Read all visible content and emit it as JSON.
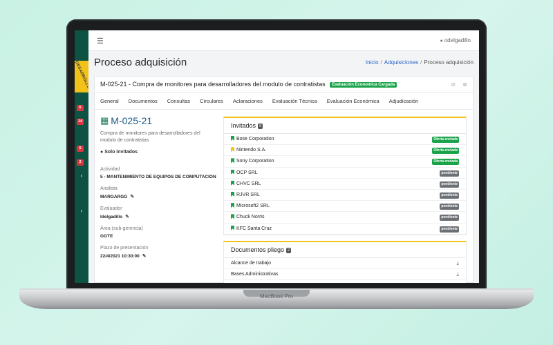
{
  "device": {
    "brand": "MacBook Pro"
  },
  "sidebar": {
    "ribbon": "DESARROLLO",
    "badges": [
      "6",
      "14",
      "5",
      "2"
    ],
    "chevron_icon": "chevron-left-icon"
  },
  "topbar": {
    "username": "odelgadillo"
  },
  "page": {
    "title": "Proceso adquisición",
    "breadcrumb": {
      "home": "Inicio",
      "section": "Adquisiciones",
      "current": "Proceso adquisición"
    }
  },
  "process": {
    "header": "M-025-21 - Compra de monitores para desarrolladores del modulo de contratistas",
    "status_badge": "Evaluación Economica Cargada",
    "code": "M-025-21",
    "description": "Compra de monitores para desarrolladores del modulo de contratistas",
    "mode": "Solo invitados",
    "fields": {
      "actividad_label": "Actividad",
      "actividad_value": "5 - MANTENIMIENTO DE EQUIPOS DE COMPUTACION",
      "analista_label": "Analista",
      "analista_value": "MARGARGG",
      "evaluador_label": "Evaluador",
      "evaluador_value": "ldelgadillo",
      "area_label": "Área (sub-gerencia)",
      "area_value": "GGTE",
      "plazo_label": "Plazo de presentación",
      "plazo_value": "22/4/2021 10:30:00"
    }
  },
  "tabs": [
    "General",
    "Documentos",
    "Consultas",
    "Circulares",
    "Aclaraciones",
    "Evaluación Técnica",
    "Evaluación Económica",
    "Adjudicación"
  ],
  "invitados": {
    "title": "Invitados",
    "count": "9",
    "rows": [
      {
        "name": "Bose Corporation",
        "status": "Oferta enviada",
        "color": "#1aa34a",
        "mark": "#1aa34a"
      },
      {
        "name": "Nintendo S.A.",
        "status": "Oferta enviada",
        "color": "#1aa34a",
        "mark": "#f2c21b"
      },
      {
        "name": "Sony Corporation",
        "status": "Oferta enviada",
        "color": "#1aa34a",
        "mark": "#1aa34a"
      },
      {
        "name": "OCP SRL",
        "status": "pendiente",
        "color": "#6b7075",
        "mark": "#1aa34a"
      },
      {
        "name": "CHVC SRL",
        "status": "pendiente",
        "color": "#6b7075",
        "mark": "#1aa34a"
      },
      {
        "name": "RJVR SRL",
        "status": "pendiente",
        "color": "#6b7075",
        "mark": "#1aa34a"
      },
      {
        "name": "Microsoft2 SRL",
        "status": "pendiente",
        "color": "#6b7075",
        "mark": "#1aa34a"
      },
      {
        "name": "Chuck Norris",
        "status": "pendiente",
        "color": "#6b7075",
        "mark": "#1aa34a"
      },
      {
        "name": "KFC Santa Cruz",
        "status": "pendiente",
        "color": "#6b7075",
        "mark": "#1aa34a"
      }
    ]
  },
  "documentos": {
    "title": "Documentos pliego",
    "count": "2",
    "rows": [
      "Alcance de trabajo",
      "Bases Administrativas"
    ]
  }
}
